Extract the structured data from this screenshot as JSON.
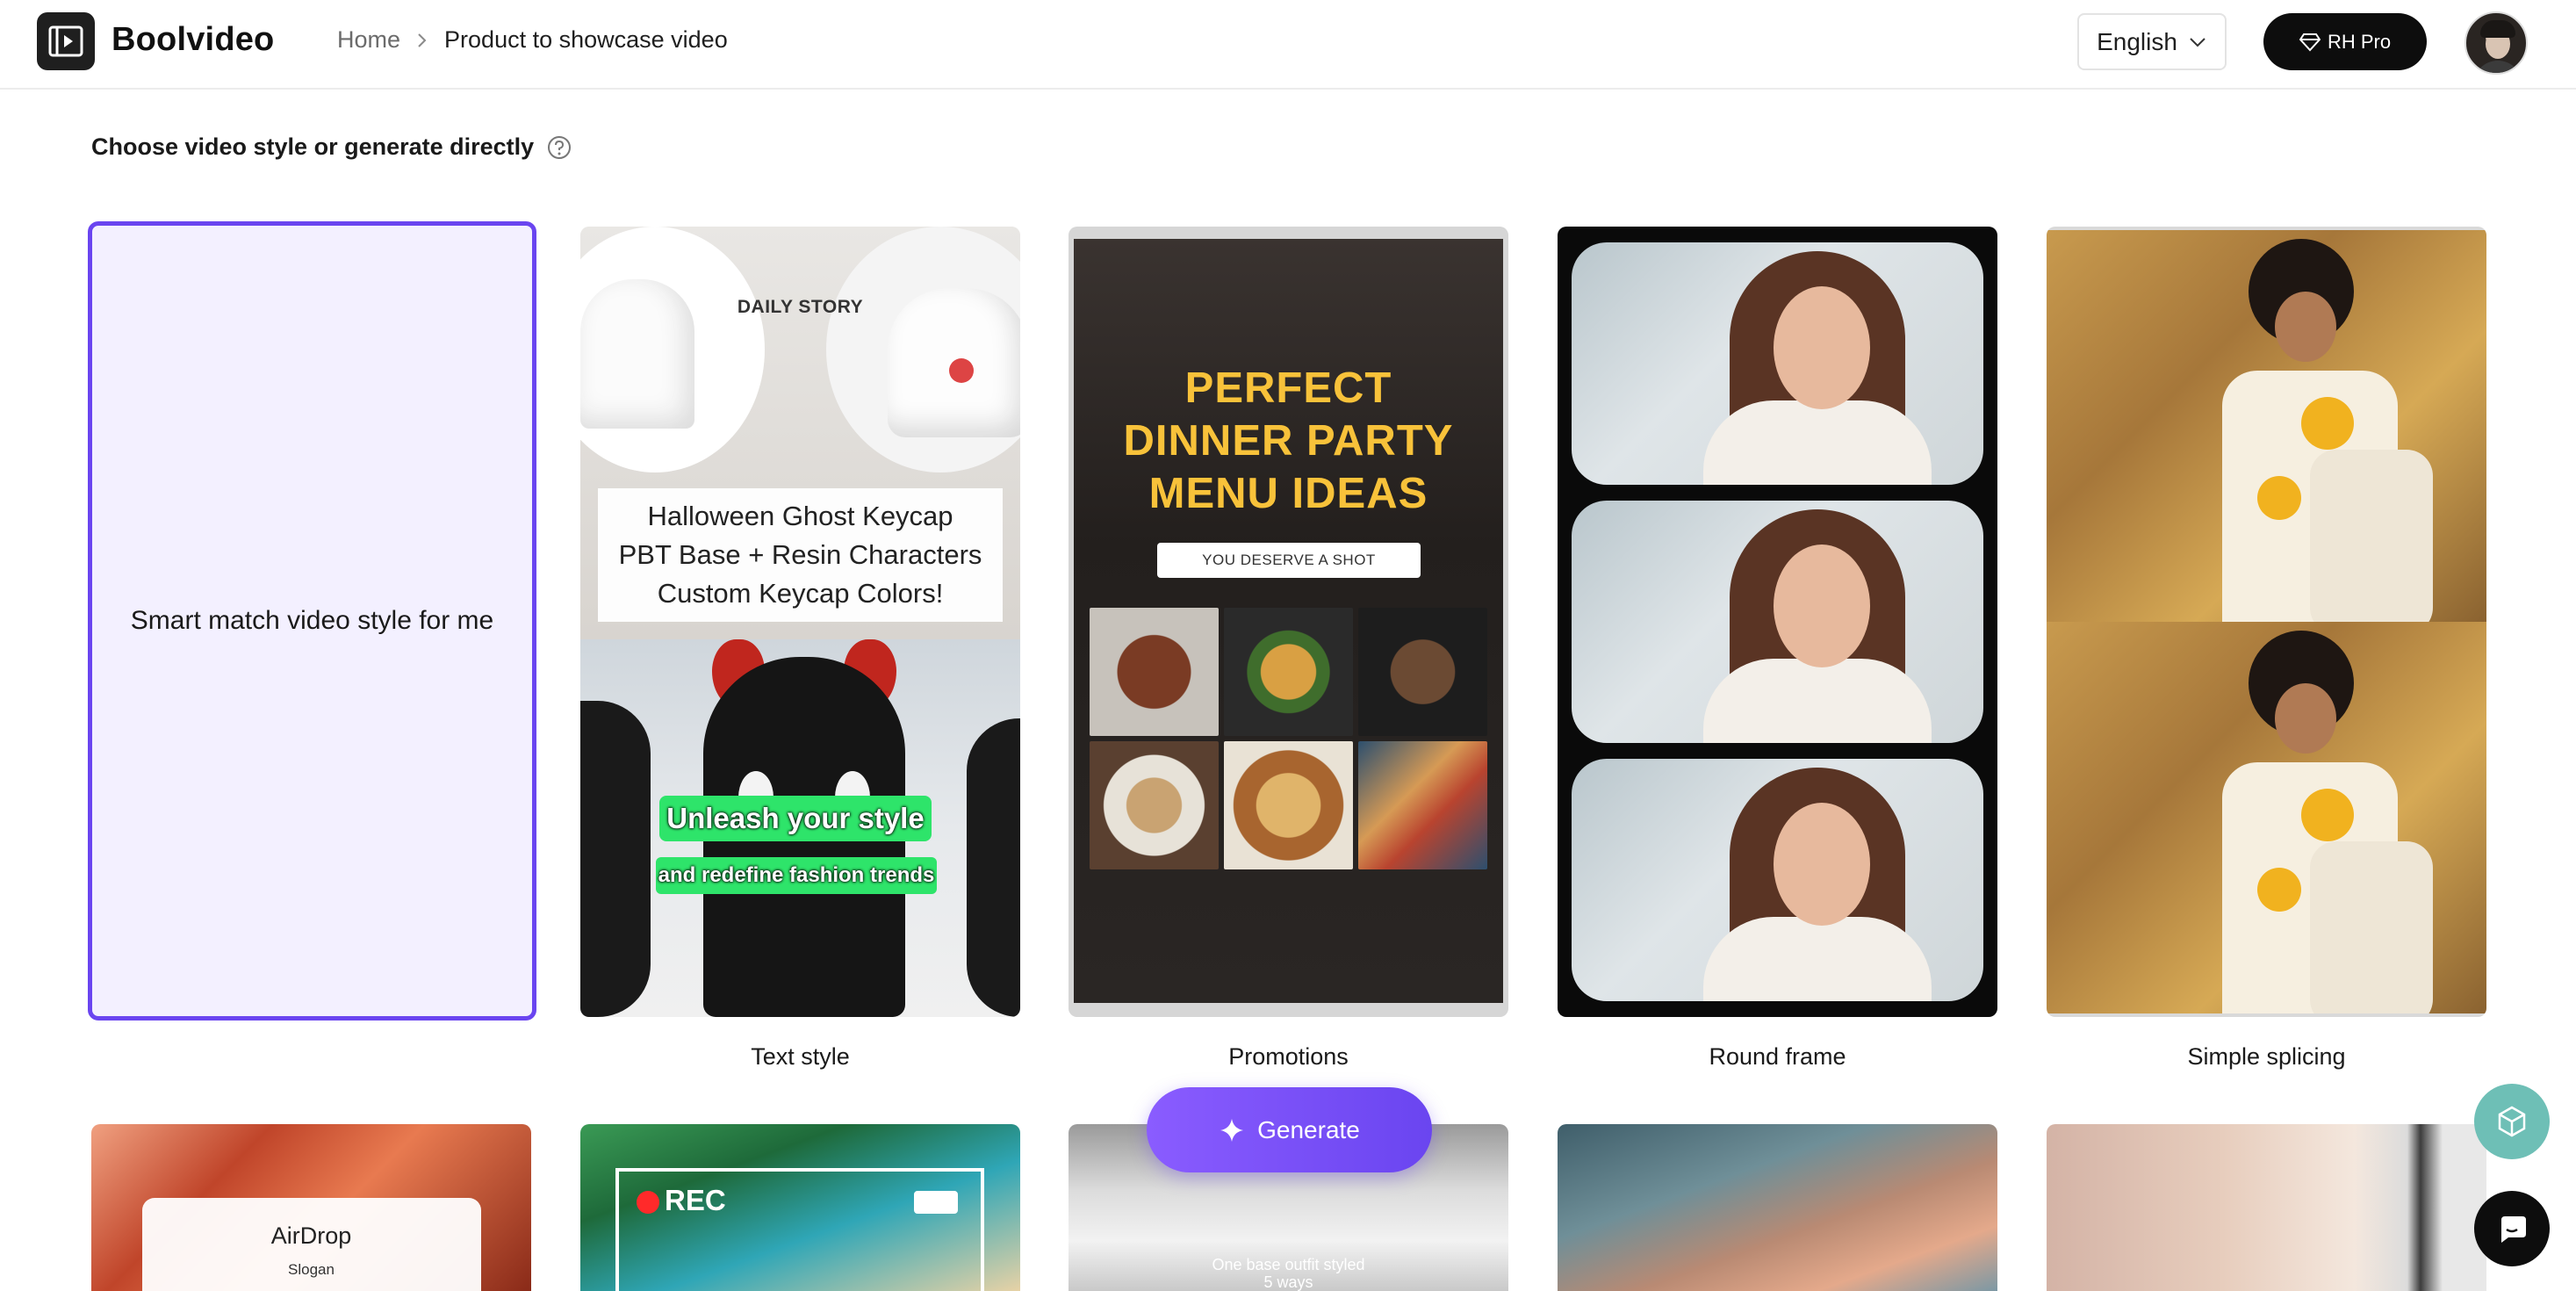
{
  "header": {
    "brand": "Boolvideo",
    "breadcrumb": {
      "home": "Home",
      "current": "Product to showcase video"
    },
    "language": "English",
    "pro_label": "RH Pro"
  },
  "section": {
    "title": "Choose video style or generate directly"
  },
  "styles": {
    "smart": {
      "label": "Smart match video style for me"
    },
    "text_style": {
      "caption": "Text style",
      "daily": "DAILY STORY",
      "line1": "Halloween Ghost Keycap",
      "line2": "PBT Base + Resin Characters",
      "line3": "Custom Keycap Colors!",
      "tag1": "Unleash your style",
      "tag2": "and redefine fashion trends"
    },
    "promotions": {
      "caption": "Promotions",
      "title1": "PERFECT",
      "title2": "DINNER PARTY",
      "title3": "MENU IDEAS",
      "sub": "YOU DESERVE A SHOT"
    },
    "round_frame": {
      "caption": "Round frame"
    },
    "simple_splicing": {
      "caption": "Simple splicing"
    }
  },
  "bottom_row": {
    "airdrop": {
      "title": "AirDrop",
      "sub": "Slogan"
    },
    "rec": {
      "label": "REC"
    },
    "outfit": {
      "line1": "One base outfit styled",
      "line2": "5 ways"
    }
  },
  "actions": {
    "generate": "Generate"
  },
  "colors": {
    "accent": "#6a45f0",
    "smart_bg": "#f3f0ff",
    "pro_bg": "#0d0d0d",
    "promo_yellow": "#f8c23a"
  }
}
